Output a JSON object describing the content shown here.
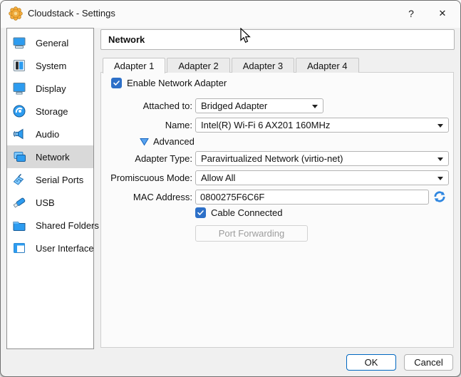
{
  "window": {
    "title": "Cloudstack - Settings",
    "help_glyph": "?",
    "close_glyph": "✕"
  },
  "sidebar": {
    "selected": "Network",
    "items": [
      {
        "label": "General",
        "icon": "general-icon"
      },
      {
        "label": "System",
        "icon": "system-icon"
      },
      {
        "label": "Display",
        "icon": "display-icon"
      },
      {
        "label": "Storage",
        "icon": "storage-icon"
      },
      {
        "label": "Audio",
        "icon": "audio-icon"
      },
      {
        "label": "Network",
        "icon": "network-icon"
      },
      {
        "label": "Serial Ports",
        "icon": "serial-ports-icon"
      },
      {
        "label": "USB",
        "icon": "usb-icon"
      },
      {
        "label": "Shared Folders",
        "icon": "shared-folders-icon"
      },
      {
        "label": "User Interface",
        "icon": "user-interface-icon"
      }
    ]
  },
  "header": {
    "title": "Network"
  },
  "tabs": [
    {
      "label": "Adapter 1",
      "active": true
    },
    {
      "label": "Adapter 2",
      "active": false
    },
    {
      "label": "Adapter 3",
      "active": false
    },
    {
      "label": "Adapter 4",
      "active": false
    }
  ],
  "form": {
    "enable_checkbox_label": "Enable Network Adapter",
    "attached": {
      "label": "Attached to:",
      "value": "Bridged Adapter"
    },
    "name": {
      "label": "Name:",
      "value": "Intel(R) Wi-Fi 6 AX201 160MHz"
    },
    "advanced_label": "Advanced",
    "adapter_type": {
      "label": "Adapter Type:",
      "value": "Paravirtualized Network (virtio-net)"
    },
    "promiscuous": {
      "label": "Promiscuous Mode:",
      "value": "Allow All"
    },
    "mac": {
      "label": "MAC Address:",
      "value": "0800275F6C6F"
    },
    "cable_checkbox_label": "Cable Connected",
    "port_forwarding_label": "Port Forwarding"
  },
  "footer": {
    "ok": "OK",
    "cancel": "Cancel"
  },
  "colors": {
    "accent_checkbox": "#2d70c8",
    "ok_border": "#0067c0",
    "selected_item_bg": "#d9d9d9",
    "icon_blue": "#2d9cf0",
    "gear_orange": "#f3aa3c"
  }
}
